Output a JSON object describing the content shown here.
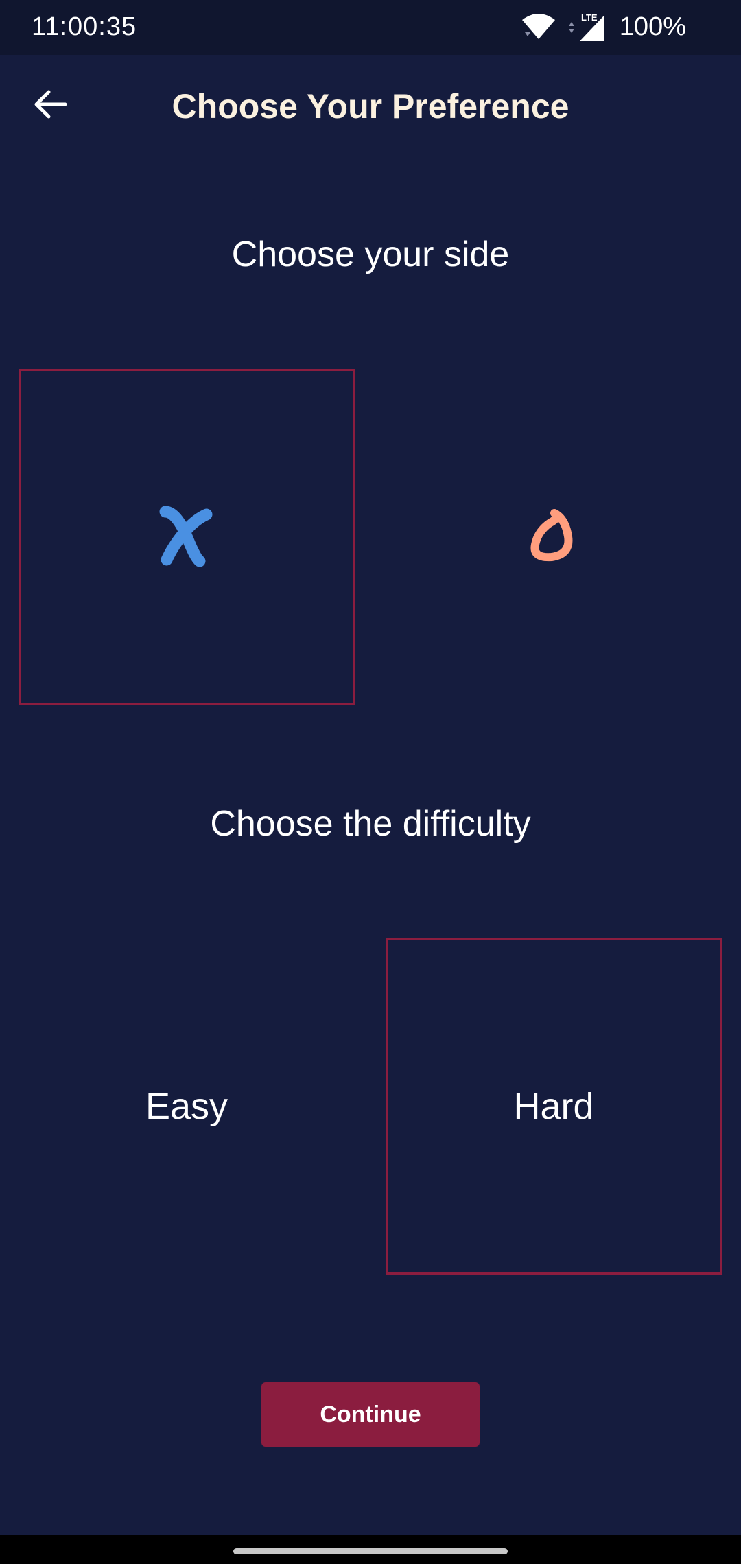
{
  "status_bar": {
    "time": "11:00:35",
    "network": "LTE",
    "battery": "100%",
    "icons": [
      "wifi-icon",
      "lte-signal-icon"
    ]
  },
  "app_bar": {
    "title": "Choose Your Preference",
    "back_icon": "arrow-left-icon"
  },
  "side_section": {
    "heading": "Choose your side",
    "options": [
      {
        "icon": "x-mark-icon",
        "color": "#4a90e2",
        "selected": true
      },
      {
        "icon": "o-mark-icon",
        "color": "#ff9e7e",
        "selected": false
      }
    ]
  },
  "difficulty_section": {
    "heading": "Choose the difficulty",
    "options": [
      {
        "label": "Easy",
        "selected": false
      },
      {
        "label": "Hard",
        "selected": true
      }
    ]
  },
  "continue_label": "Continue",
  "colors": {
    "background": "#151c3e",
    "accent": "#8b1d3f",
    "title": "#fbf1e0"
  }
}
